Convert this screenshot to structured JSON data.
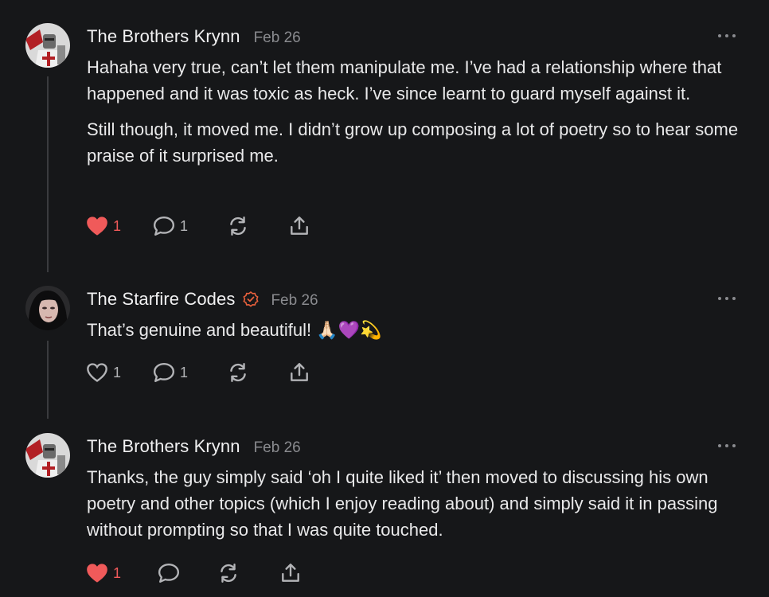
{
  "comments": [
    {
      "author": "The Brothers Krynn",
      "date": "Feb 26",
      "verified": false,
      "paragraphs": [
        "Hahaha very true, can’t let them manipulate me. I’ve had a relationship where that happened and it was toxic as heck. I’ve since learnt to guard myself against it.",
        "Still though, it moved me. I didn’t grow up composing a lot of poetry so to hear some praise of it surprised me."
      ],
      "liked": true,
      "like_count": "1",
      "reply_count": "1"
    },
    {
      "author": "The Starfire Codes",
      "date": "Feb 26",
      "verified": true,
      "paragraphs": [
        "That’s genuine and beautiful! 🙏🏻💜💫"
      ],
      "liked": false,
      "like_count": "1",
      "reply_count": "1"
    },
    {
      "author": "The Brothers Krynn",
      "date": "Feb 26",
      "verified": false,
      "paragraphs": [
        "Thanks, the guy simply said ‘oh I quite liked it’ then moved to discussing his own poetry and other topics (which I enjoy reading about) and simply said it in passing without prompting so that I was quite touched."
      ],
      "liked": true,
      "like_count": "1",
      "reply_count": ""
    }
  ],
  "colors": {
    "background": "#161719",
    "like_active": "#f05a5a",
    "verified_badge": "#e8603c",
    "muted": "#8a8b8f"
  },
  "icons": [
    "heart-icon",
    "comment-icon",
    "restack-icon",
    "share-icon",
    "more-icon",
    "verified-icon"
  ]
}
